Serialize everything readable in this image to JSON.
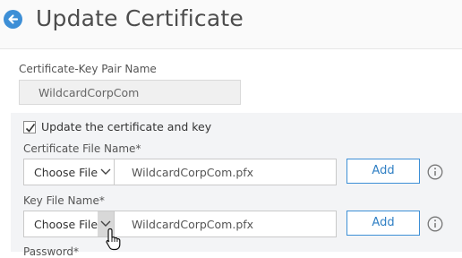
{
  "header": {
    "title": "Update Certificate"
  },
  "pair_name": {
    "label": "Certificate-Key Pair Name",
    "value": "WildcardCorpCom"
  },
  "update_checkbox": {
    "label": "Update the certificate and key",
    "checked": true
  },
  "cert_file": {
    "label": "Certificate File Name*",
    "choose_label": "Choose File",
    "file_name": "WildcardCorpCom.pfx",
    "add_label": "Add"
  },
  "key_file": {
    "label": "Key File Name*",
    "choose_label": "Choose File",
    "file_name": "WildcardCorpCom.pfx",
    "add_label": "Add"
  },
  "password": {
    "label": "Password*"
  },
  "colors": {
    "accent": "#3d8fd6",
    "panel_bg": "#f3f4f6"
  },
  "icons": [
    "back-arrow-icon",
    "checkmark-icon",
    "chevron-down-icon",
    "info-icon",
    "pointer-cursor-icon"
  ]
}
